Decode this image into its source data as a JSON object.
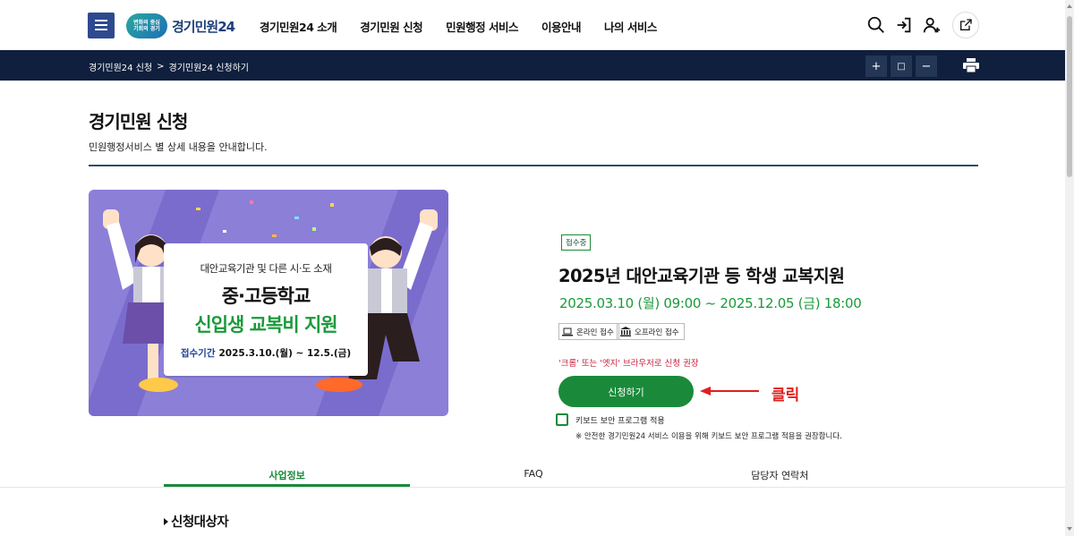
{
  "header": {
    "logo_badge_line1": "변화의 중심",
    "logo_badge_line2": "기회의 경기",
    "logo_text": "경기민원24",
    "nav": [
      "경기민원24 소개",
      "경기민원 신청",
      "민원행정 서비스",
      "이용안내",
      "나의 서비스"
    ],
    "icons": [
      "search-icon",
      "login-icon",
      "user-add-icon",
      "share-icon"
    ]
  },
  "breadcrumb": {
    "items": [
      "경기민원24 신청",
      "경기민원24 신청하기"
    ],
    "separator": ">",
    "zoom_in": "+",
    "zoom_reset": "□",
    "zoom_out": "−"
  },
  "page": {
    "title": "경기민원 신청",
    "description": "민원행정서비스 별 상세 내용을 안내합니다."
  },
  "banner": {
    "subtitle": "대안교육기관 및 다른 시·도 소재",
    "line1": "중·고등학교",
    "line2": "신입생 교복비 지원",
    "period_label": "접수기간",
    "period_value": "2025.3.10.(월) ~ 12.5.(금)"
  },
  "service": {
    "status": "접수중",
    "title": "2025년 대안교육기관 등 학생 교복지원",
    "period": "2025.03.10 (월) 09:00 ~ 2025.12.05 (금) 18:00",
    "channels": [
      {
        "label": "온라인 접수",
        "icon": "laptop-icon"
      },
      {
        "label": "오프라인 접수",
        "icon": "building-icon"
      }
    ],
    "browser_notice": "'크롬' 또는 '엣지' 브라우저로 신청 권장",
    "apply_label": "신청하기",
    "annotation": "클릭",
    "keyboard_label": "키보드 보안 프로그램 적용",
    "keyboard_checked": false,
    "keyboard_note": "※ 안전한 경기민원24 서비스 이용을 위해 키보드 보안 프로그램 적용을 권장합니다."
  },
  "tabs": [
    {
      "label": "사업정보",
      "active": true
    },
    {
      "label": "FAQ",
      "active": false
    },
    {
      "label": "담당자 연락처",
      "active": false
    }
  ],
  "section": {
    "heading": "신청대상자"
  },
  "colors": {
    "brand_navy": "#0f1f3d",
    "menu_blue": "#2e4a8f",
    "accent_green": "#1a8a3a",
    "notice_red": "#c81e3a",
    "banner_purple": "#8b7fd8"
  }
}
